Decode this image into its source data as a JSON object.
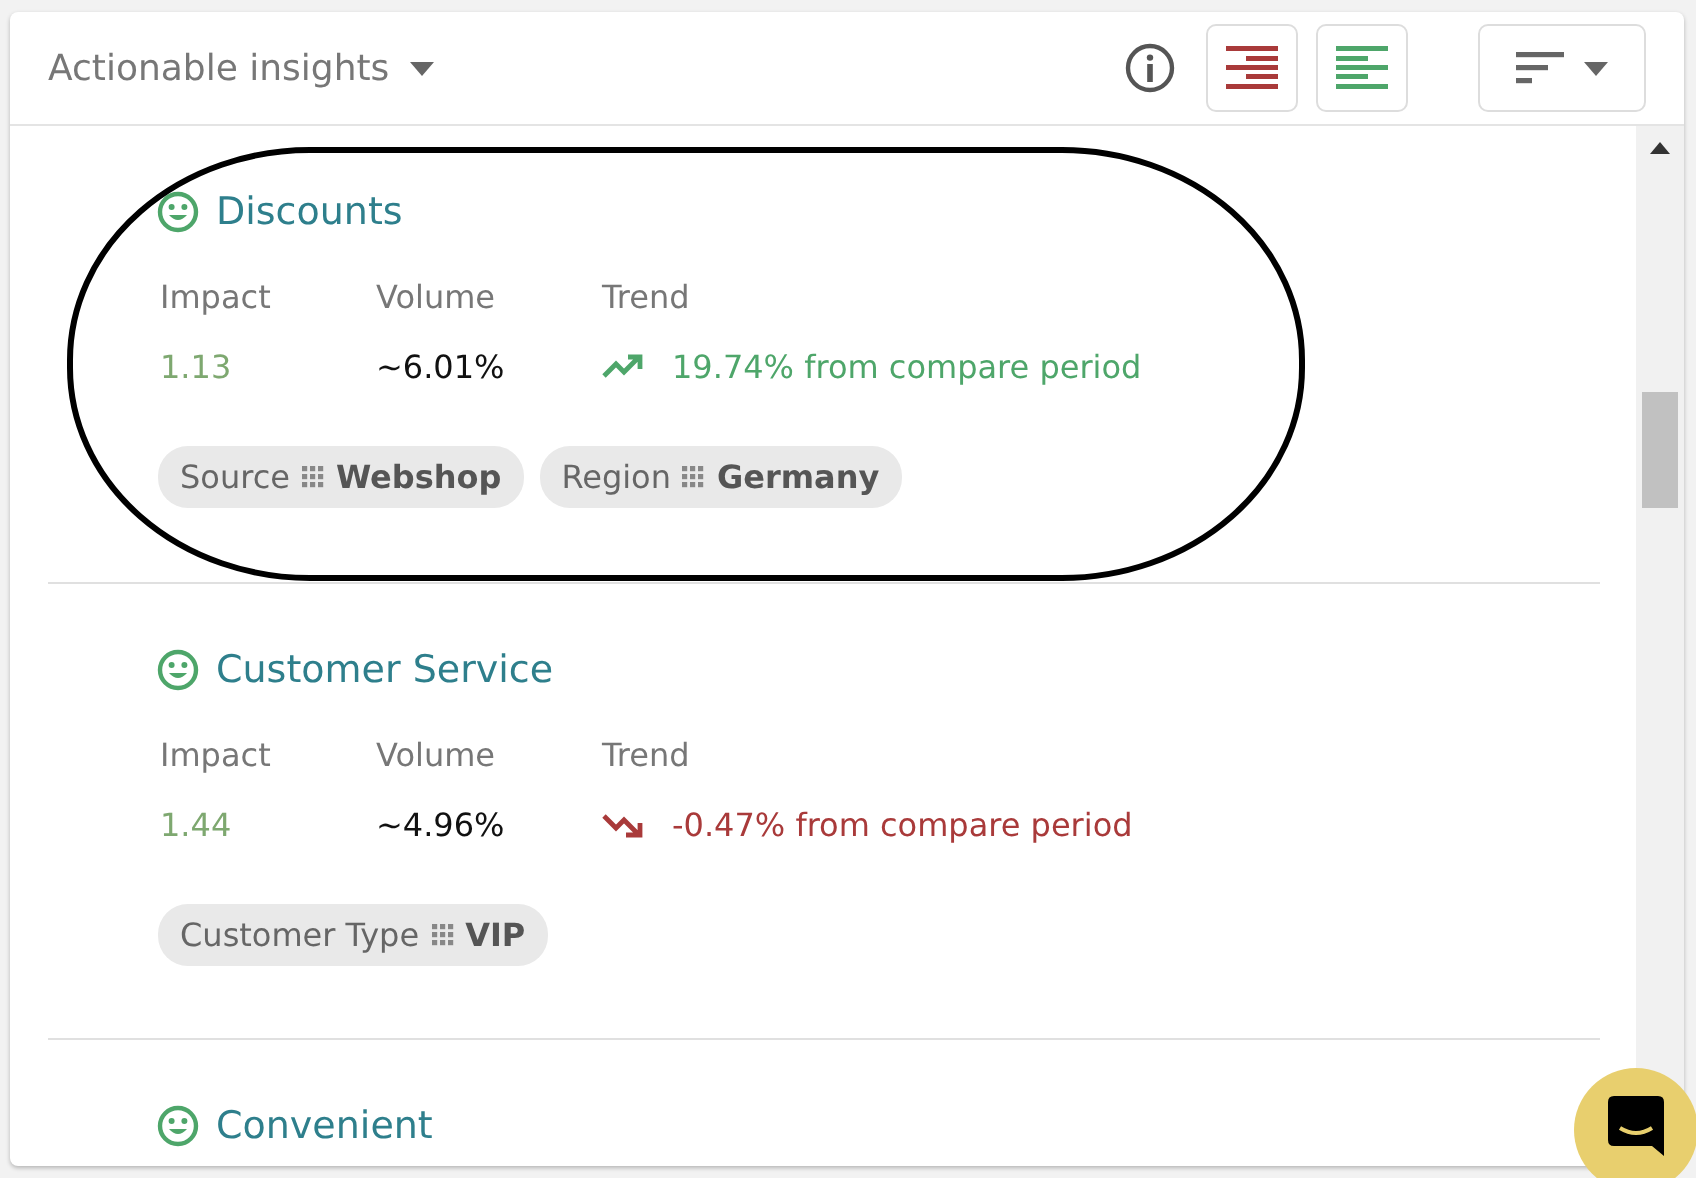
{
  "header": {
    "title": "Actionable insights"
  },
  "insights": [
    {
      "title": "Discounts",
      "highlighted": true,
      "metrics": [
        {
          "label": "Impact",
          "value": "1.13"
        },
        {
          "label": "Volume",
          "value": "~6.01%"
        }
      ],
      "trend": {
        "label": "Trend",
        "kind": "up",
        "text": "19.74% from compare period"
      },
      "tags": [
        {
          "name": "Source",
          "value": "Webshop"
        },
        {
          "name": "Region",
          "value": "Germany"
        }
      ]
    },
    {
      "title": "Customer Service",
      "highlighted": false,
      "metrics": [
        {
          "label": "Impact",
          "value": "1.44"
        },
        {
          "label": "Volume",
          "value": "~4.96%"
        }
      ],
      "trend": {
        "label": "Trend",
        "kind": "down",
        "text": "-0.47% from compare period"
      },
      "tags": [
        {
          "name": "Customer Type",
          "value": "VIP"
        }
      ]
    },
    {
      "title": "Convenient",
      "highlighted": false
    }
  ]
}
